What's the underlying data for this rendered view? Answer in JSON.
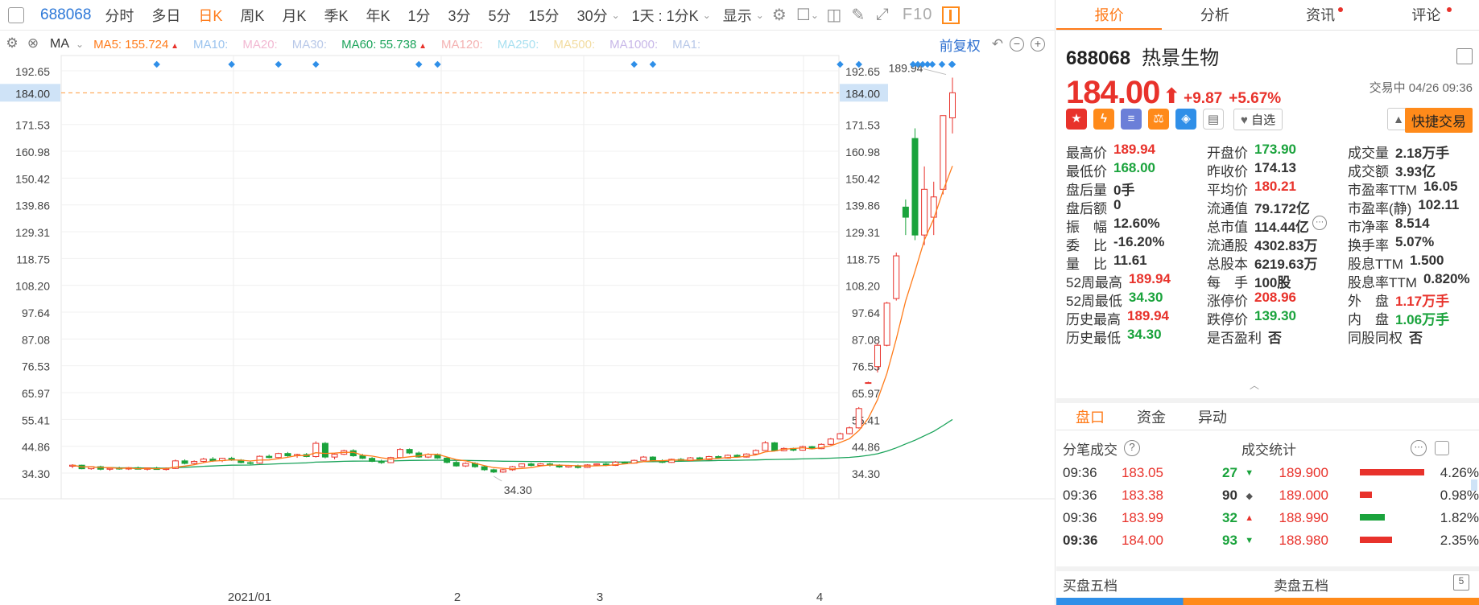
{
  "toolbar": {
    "code": "688068",
    "periods": [
      "分时",
      "多日",
      "日K",
      "周K",
      "月K",
      "季K",
      "年K",
      "1分",
      "3分",
      "5分",
      "15分",
      "30分"
    ],
    "active_period": "日K",
    "interval_select": "1天 : 1分K",
    "display_label": "显示",
    "f10_label": "F10"
  },
  "ma_bar": {
    "indicator": "MA",
    "items": [
      {
        "label": "MA5:",
        "value": "155.724",
        "color": "#ff7b1a",
        "trend": "up"
      },
      {
        "label": "MA10:",
        "value": "",
        "color": "#9cc4ee",
        "trend": ""
      },
      {
        "label": "MA20:",
        "value": "",
        "color": "#f2b8d2",
        "trend": ""
      },
      {
        "label": "MA30:",
        "value": "",
        "color": "#b8c8e8",
        "trend": ""
      },
      {
        "label": "MA60:",
        "value": "55.738",
        "color": "#1aa35a",
        "trend": "up"
      },
      {
        "label": "MA120:",
        "value": "",
        "color": "#f4b2b2",
        "trend": ""
      },
      {
        "label": "MA250:",
        "value": "",
        "color": "#a8e0f0",
        "trend": ""
      },
      {
        "label": "MA500:",
        "value": "",
        "color": "#f2dca0",
        "trend": ""
      },
      {
        "label": "MA1000:",
        "value": "",
        "color": "#c8b8e8",
        "trend": ""
      },
      {
        "label": "MA1:",
        "value": "",
        "color": "#b8c8e8",
        "trend": ""
      }
    ],
    "adjust_label": "前复权"
  },
  "chart_data": {
    "type": "candlestick",
    "price_ticks": [
      "192.65",
      "171.53",
      "160.98",
      "150.42",
      "139.86",
      "129.31",
      "118.75",
      "108.20",
      "97.64",
      "87.08",
      "76.53",
      "65.97",
      "55.41",
      "44.86",
      "34.30"
    ],
    "ylim": [
      34.3,
      192.65
    ],
    "current_price": "184.00",
    "x_ticks": [
      "2021/01",
      "2",
      "3",
      "4"
    ],
    "high_label": "189.94",
    "low_label": "34.30",
    "up_color": "#e8322b",
    "down_color": "#1aa33c",
    "ma5_color": "#ff7b1a",
    "ma60_color": "#1aa35a",
    "dot_color": "#2f8fe8",
    "candles": [
      [
        37.0,
        37.8,
        36.2,
        37.4
      ],
      [
        37.4,
        37.6,
        35.8,
        36.0
      ],
      [
        36.0,
        37.0,
        35.6,
        36.8
      ],
      [
        36.8,
        37.2,
        35.4,
        35.8
      ],
      [
        35.8,
        36.6,
        35.2,
        36.2
      ],
      [
        36.2,
        36.8,
        35.6,
        35.9
      ],
      [
        35.9,
        36.7,
        35.5,
        36.4
      ],
      [
        36.4,
        36.9,
        35.7,
        35.8
      ],
      [
        35.8,
        36.5,
        35.3,
        36.3
      ],
      [
        36.3,
        36.8,
        35.6,
        35.7
      ],
      [
        35.7,
        36.5,
        35.3,
        36.1
      ],
      [
        36.1,
        39.6,
        35.9,
        39.1
      ],
      [
        39.1,
        39.7,
        37.7,
        38.1
      ],
      [
        38.1,
        39.3,
        37.5,
        38.9
      ],
      [
        38.9,
        40.3,
        38.4,
        39.8
      ],
      [
        39.8,
        40.6,
        38.7,
        39.2
      ],
      [
        39.2,
        40.3,
        38.6,
        40.1
      ],
      [
        40.1,
        40.7,
        39.1,
        39.4
      ],
      [
        39.4,
        39.8,
        38.1,
        38.4
      ],
      [
        38.4,
        38.9,
        37.7,
        38.2
      ],
      [
        38.2,
        41.2,
        38.0,
        40.9
      ],
      [
        40.9,
        41.6,
        40.1,
        40.4
      ],
      [
        40.4,
        42.3,
        40.2,
        42.0
      ],
      [
        42.0,
        42.6,
        40.7,
        41.1
      ],
      [
        41.1,
        41.9,
        40.3,
        41.6
      ],
      [
        41.6,
        42.2,
        40.5,
        40.8
      ],
      [
        40.8,
        46.8,
        40.4,
        46.0
      ],
      [
        46.0,
        46.5,
        40.1,
        40.6
      ],
      [
        40.6,
        42.1,
        39.7,
        41.7
      ],
      [
        41.7,
        43.5,
        41.4,
        43.1
      ],
      [
        43.1,
        43.7,
        40.7,
        41.1
      ],
      [
        41.1,
        41.8,
        39.8,
        40.1
      ],
      [
        40.1,
        40.6,
        38.6,
        38.9
      ],
      [
        38.9,
        39.6,
        37.9,
        38.4
      ],
      [
        38.4,
        40.7,
        38.2,
        40.4
      ],
      [
        40.4,
        44.1,
        40.0,
        43.6
      ],
      [
        43.6,
        44.0,
        41.8,
        42.2
      ],
      [
        42.2,
        42.8,
        40.3,
        40.6
      ],
      [
        40.6,
        42.1,
        40.2,
        41.6
      ],
      [
        41.6,
        42.0,
        39.9,
        40.2
      ],
      [
        40.2,
        40.6,
        38.1,
        38.5
      ],
      [
        38.5,
        39.1,
        36.8,
        37.1
      ],
      [
        37.1,
        38.5,
        36.7,
        38.1
      ],
      [
        38.1,
        38.6,
        36.4,
        36.8
      ],
      [
        36.8,
        37.3,
        35.2,
        35.6
      ],
      [
        35.6,
        36.0,
        34.3,
        34.7
      ],
      [
        34.7,
        35.9,
        34.4,
        35.6
      ],
      [
        35.6,
        37.1,
        35.2,
        36.8
      ],
      [
        36.8,
        38.1,
        36.5,
        37.9
      ],
      [
        37.9,
        38.4,
        36.9,
        37.3
      ],
      [
        37.3,
        38.2,
        37.0,
        37.9
      ],
      [
        37.9,
        38.3,
        36.9,
        37.4
      ],
      [
        37.4,
        37.8,
        36.3,
        36.7
      ],
      [
        36.7,
        37.5,
        36.4,
        37.2
      ],
      [
        37.2,
        37.6,
        36.1,
        36.5
      ],
      [
        36.5,
        37.8,
        36.3,
        37.5
      ],
      [
        37.5,
        38.1,
        37.2,
        37.9
      ],
      [
        37.9,
        38.3,
        37.0,
        37.3
      ],
      [
        37.3,
        39.0,
        37.1,
        38.6
      ],
      [
        38.6,
        38.9,
        37.9,
        38.2
      ],
      [
        38.2,
        39.6,
        38.0,
        39.3
      ],
      [
        39.3,
        41.0,
        39.1,
        40.6
      ],
      [
        40.6,
        40.9,
        38.7,
        39.1
      ],
      [
        39.1,
        39.7,
        38.2,
        38.5
      ],
      [
        38.5,
        40.0,
        38.3,
        39.7
      ],
      [
        39.7,
        40.2,
        38.9,
        39.2
      ],
      [
        39.2,
        40.6,
        39.0,
        40.3
      ],
      [
        40.3,
        40.7,
        39.3,
        39.6
      ],
      [
        39.6,
        41.1,
        39.4,
        40.8
      ],
      [
        40.8,
        41.2,
        39.9,
        40.2
      ],
      [
        40.2,
        41.6,
        40.0,
        41.3
      ],
      [
        41.3,
        41.7,
        40.3,
        40.6
      ],
      [
        40.6,
        42.1,
        40.4,
        41.8
      ],
      [
        41.8,
        43.6,
        41.6,
        43.2
      ],
      [
        43.2,
        46.9,
        43.0,
        46.2
      ],
      [
        46.2,
        46.6,
        42.8,
        43.1
      ],
      [
        43.1,
        44.4,
        42.9,
        44.0
      ],
      [
        44.0,
        44.3,
        42.9,
        43.3
      ],
      [
        43.3,
        45.1,
        43.1,
        44.7
      ],
      [
        44.7,
        45.0,
        43.6,
        43.9
      ],
      [
        43.9,
        46.0,
        43.7,
        45.6
      ],
      [
        45.6,
        48.1,
        45.3,
        47.7
      ],
      [
        47.7,
        50.2,
        47.5,
        49.8
      ],
      [
        49.8,
        52.6,
        49.5,
        52.1
      ],
      [
        52.1,
        60.3,
        51.8,
        59.7
      ],
      [
        69.9,
        70.3,
        69.7,
        69.9
      ],
      [
        76.2,
        85.5,
        73.9,
        84.6
      ],
      [
        84.6,
        101.7,
        84.2,
        101.2
      ],
      [
        103.0,
        121.1,
        102.2,
        119.8
      ],
      [
        139.0,
        142.0,
        128.0,
        135.0
      ],
      [
        166.0,
        170.0,
        126.0,
        128.0
      ],
      [
        128.0,
        155.0,
        124.0,
        146.0
      ],
      [
        135.0,
        149.0,
        128.0,
        143.0
      ],
      [
        146.0,
        159.0,
        144.0,
        175.0
      ],
      [
        174.13,
        189.94,
        168.0,
        184.0
      ]
    ]
  },
  "quote": {
    "tabs": [
      "报价",
      "分析",
      "资讯",
      "评论"
    ],
    "code": "688068",
    "name": "热景生物",
    "price": "184.00",
    "change": "+9.87",
    "change_pct": "+5.67%",
    "status": "交易中 04/26 09:36",
    "watch_label": "自选",
    "fast_trade_label": "快捷交易",
    "grid": [
      [
        {
          "l": "最高价",
          "v": "189.94",
          "c": "red"
        },
        {
          "l": "开盘价",
          "v": "173.90",
          "c": "green"
        },
        {
          "l": "成交量",
          "v": "2.18万手",
          "c": ""
        }
      ],
      [
        {
          "l": "最低价",
          "v": "168.00",
          "c": "green"
        },
        {
          "l": "昨收价",
          "v": "174.13",
          "c": ""
        },
        {
          "l": "成交额",
          "v": "3.93亿",
          "c": ""
        }
      ],
      [
        {
          "l": "盘后量",
          "v": "0手",
          "c": ""
        },
        {
          "l": "平均价",
          "v": "180.21",
          "c": "red"
        },
        {
          "l": "市盈率TTM",
          "v": "16.05",
          "c": ""
        }
      ],
      [
        {
          "l": "盘后额",
          "v": "0",
          "c": ""
        },
        {
          "l": "流通值",
          "v": "79.172亿",
          "c": ""
        },
        {
          "l": "市盈率(静)",
          "v": "102.11",
          "c": ""
        }
      ],
      [
        {
          "l": "振　幅",
          "v": "12.60%",
          "c": ""
        },
        {
          "l": "总市值",
          "v": "114.44亿",
          "c": ""
        },
        {
          "l": "市净率",
          "v": "8.514",
          "c": ""
        }
      ],
      [
        {
          "l": "委　比",
          "v": "-16.20%",
          "c": ""
        },
        {
          "l": "流通股",
          "v": "4302.83万",
          "c": ""
        },
        {
          "l": "换手率",
          "v": "5.07%",
          "c": ""
        }
      ],
      [
        {
          "l": "量　比",
          "v": "11.61",
          "c": ""
        },
        {
          "l": "总股本",
          "v": "6219.63万",
          "c": ""
        },
        {
          "l": "股息TTM",
          "v": "1.500",
          "c": ""
        }
      ],
      [
        {
          "l": "52周最高",
          "v": "189.94",
          "c": "red"
        },
        {
          "l": "每　手",
          "v": "100股",
          "c": ""
        },
        {
          "l": "股息率TTM",
          "v": "0.820%",
          "c": ""
        }
      ],
      [
        {
          "l": "52周最低",
          "v": "34.30",
          "c": "green"
        },
        {
          "l": "涨停价",
          "v": "208.96",
          "c": "red"
        },
        {
          "l": "外　盘",
          "v": "1.17万手",
          "c": "red"
        }
      ],
      [
        {
          "l": "历史最高",
          "v": "189.94",
          "c": "red"
        },
        {
          "l": "跌停价",
          "v": "139.30",
          "c": "green"
        },
        {
          "l": "内　盘",
          "v": "1.06万手",
          "c": "green"
        }
      ],
      [
        {
          "l": "历史最低",
          "v": "34.30",
          "c": "green"
        },
        {
          "l": "是否盈利",
          "v": "否",
          "c": ""
        },
        {
          "l": "同股同权",
          "v": "否",
          "c": ""
        }
      ]
    ],
    "subtabs": [
      "盘口",
      "资金",
      "异动"
    ],
    "trades_title": "分笔成交",
    "stats_title": "成交统计",
    "trades": [
      {
        "time": "09:36",
        "price": "183.05",
        "vol": "27",
        "dir": "down"
      },
      {
        "time": "09:36",
        "price": "183.38",
        "vol": "90",
        "dir": "flat"
      },
      {
        "time": "09:36",
        "price": "183.99",
        "vol": "32",
        "dir": "up"
      },
      {
        "time": "09:36",
        "price": "184.00",
        "vol": "93",
        "dir": "down"
      }
    ],
    "stats": [
      {
        "price": "189.900",
        "pct": "4.26%",
        "color": "red",
        "bar": 1.0
      },
      {
        "price": "189.000",
        "pct": "0.98%",
        "color": "red",
        "bar": 0.18
      },
      {
        "price": "188.990",
        "pct": "1.82%",
        "color": "green",
        "bar": 0.38
      },
      {
        "price": "188.980",
        "pct": "2.35%",
        "color": "red",
        "bar": 0.5
      }
    ],
    "bid_five": "买盘五档",
    "ask_five": "卖盘五档"
  }
}
